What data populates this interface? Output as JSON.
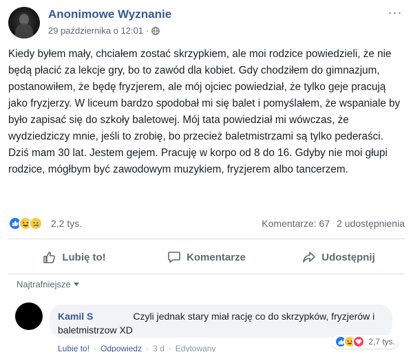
{
  "post": {
    "page_name": "Anonimowe Wyznanie",
    "date": "29 października o 12:01",
    "separator": "·",
    "more_label": "···",
    "text": [
      "Kiedy byłem mały, chciałem zostać skrzypkiem, ale moi rodzice powiedzieli, że nie będą płacić za lekcje gry, bo to zawód dla kobiet. Gdy chodziłem do gimnazjum, postanowiłem, że będę fryzjerem, ale mój ojciec powiedział, że tylko geje pracują jako fryzjerzy. W liceum bardzo spodobał mi się balet i pomyślałem, że wspaniale by było zapisać się do szkoły baletowej. Mój tata powiedział mi wówczas, że wydziedziczy mnie, jeśli to zrobię, bo przecież baletmistrzami są tylko pederaści.",
      "Dziś mam 30 lat. Jestem gejem. Pracuję w korpo od 8 do 16. Gdyby nie moi głupi rodzice, mógłbym być zawodowym muzykiem, fryzjerem albo tancerzem."
    ]
  },
  "reactions": {
    "icons": [
      "like-reaction-icon",
      "haha-reaction-icon",
      "sad-reaction-icon"
    ],
    "count": "2,2 tys.",
    "comments": "Komentarze: 67",
    "shares": "2 udostępnienia"
  },
  "actions": {
    "like": "Lubię to!",
    "comment": "Komentarze",
    "share": "Udostępnij"
  },
  "sort": {
    "label": "Najtrafniejsze"
  },
  "comment": {
    "author": "Kamil S",
    "text": "Czyli jednak stary miał rację co do skrzypków, fryzjerów i baletmistrzow XD",
    "reaction_icons": [
      "like-reaction-icon",
      "haha-reaction-icon",
      "love-reaction-icon"
    ],
    "reaction_count": "2,7 tys.",
    "like_label": "Lubię to!",
    "reply_label": "Odpowiedz",
    "age": "3 d",
    "edited": "Edytowany",
    "separator": "·"
  },
  "colors": {
    "link_blue": "#385898",
    "like_blue": "#2078f4",
    "haha_yellow": "#f7c948",
    "love_red": "#f0405e",
    "muted_gray": "#606770"
  }
}
